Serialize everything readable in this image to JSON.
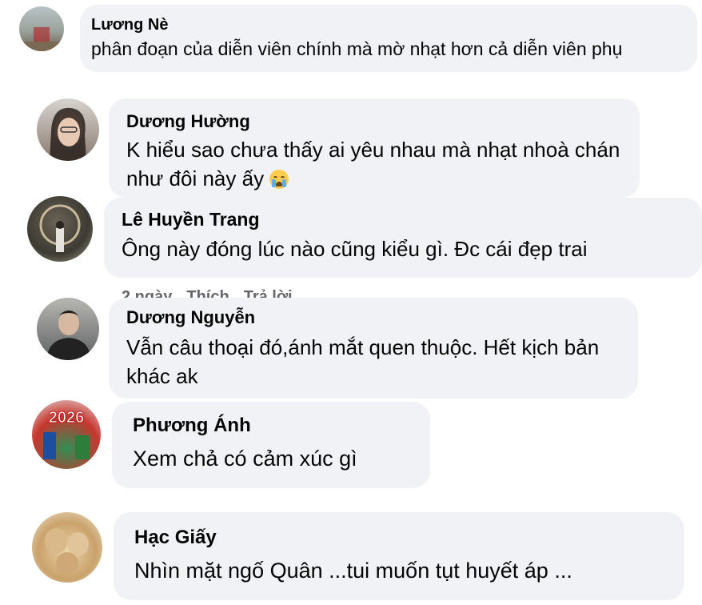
{
  "comments": [
    {
      "name": "Lương Nè",
      "text": "phân đoạn của diễn viên chính mà mờ nhạt hơn cả diễn viên phụ"
    },
    {
      "name": "Dương Hường",
      "text": "K hiểu sao chưa thấy ai yêu nhau mà nhạt nhoà chán như đôi này ấy"
    },
    {
      "name": "Lê Huyền Trang",
      "text": "Ông này đóng lúc nào cũng kiểu gì. Đc cái đẹp trai"
    },
    {
      "name": "Dương Nguyễn",
      "text": "Vẫn câu thoại đó,ánh mắt quen thuộc. Hết kịch bản khác ak"
    },
    {
      "name": "Phương Ánh",
      "text": "Xem chả có cảm xúc gì"
    },
    {
      "name": "Hạc Giấy",
      "text": "Nhìn mặt ngố Quân ...tui muốn tụt huyết áp ..."
    }
  ],
  "meta_partial": {
    "time": "2 ngày",
    "like": "Thích",
    "reply": "Trả lời"
  },
  "avatar_badge": "2026",
  "colors": {
    "bubble": "#f0f2f5",
    "text": "#050505",
    "meta": "#65676b"
  },
  "icons": {
    "crying_emoji": "loudly-crying-face-emoji"
  }
}
